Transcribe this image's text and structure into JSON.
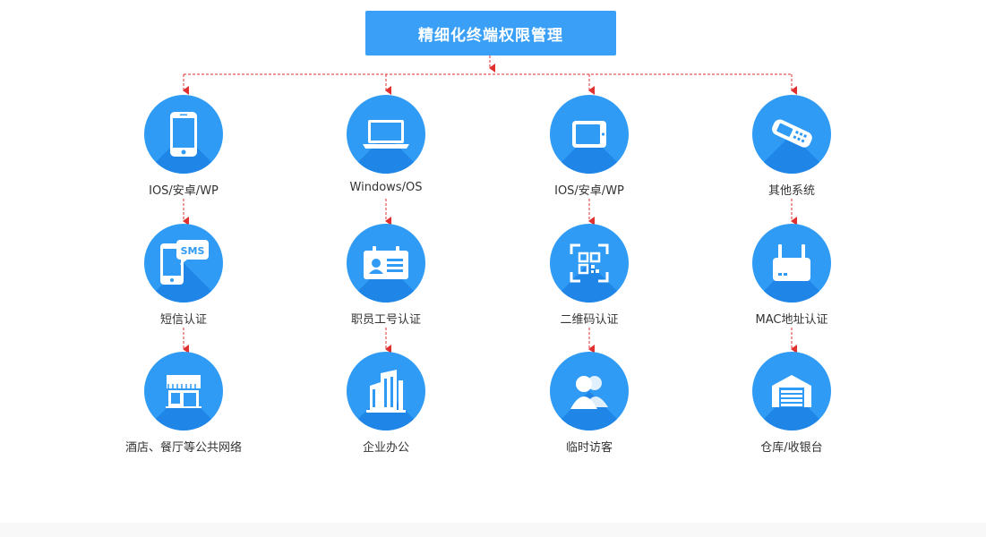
{
  "title": "精细化终端权限管理",
  "columns": [
    {
      "nodes": [
        {
          "label": "IOS/安卓/WP",
          "icon": "smartphone-icon"
        },
        {
          "label": "短信认证",
          "icon": "sms-phone-icon",
          "badge": "SMS"
        },
        {
          "label": "酒店、餐厅等公共网络",
          "icon": "storefront-icon"
        }
      ]
    },
    {
      "nodes": [
        {
          "label": "Windows/OS",
          "icon": "laptop-icon"
        },
        {
          "label": "职员工号认证",
          "icon": "employee-id-card-icon"
        },
        {
          "label": "企业办公",
          "icon": "office-building-icon"
        }
      ]
    },
    {
      "nodes": [
        {
          "label": "IOS/安卓/WP",
          "icon": "tablet-icon"
        },
        {
          "label": "二维码认证",
          "icon": "qr-code-scan-icon"
        },
        {
          "label": "临时访客",
          "icon": "visitors-icon"
        }
      ]
    },
    {
      "nodes": [
        {
          "label": "其他系统",
          "icon": "pos-terminal-icon"
        },
        {
          "label": "MAC地址认证",
          "icon": "router-icon"
        },
        {
          "label": "仓库/收银台",
          "icon": "warehouse-icon"
        }
      ]
    }
  ],
  "colors": {
    "title_bg": "#3aa0f7",
    "circle": "#2f9bf4",
    "connector": "#e03030",
    "label": "#333333"
  }
}
